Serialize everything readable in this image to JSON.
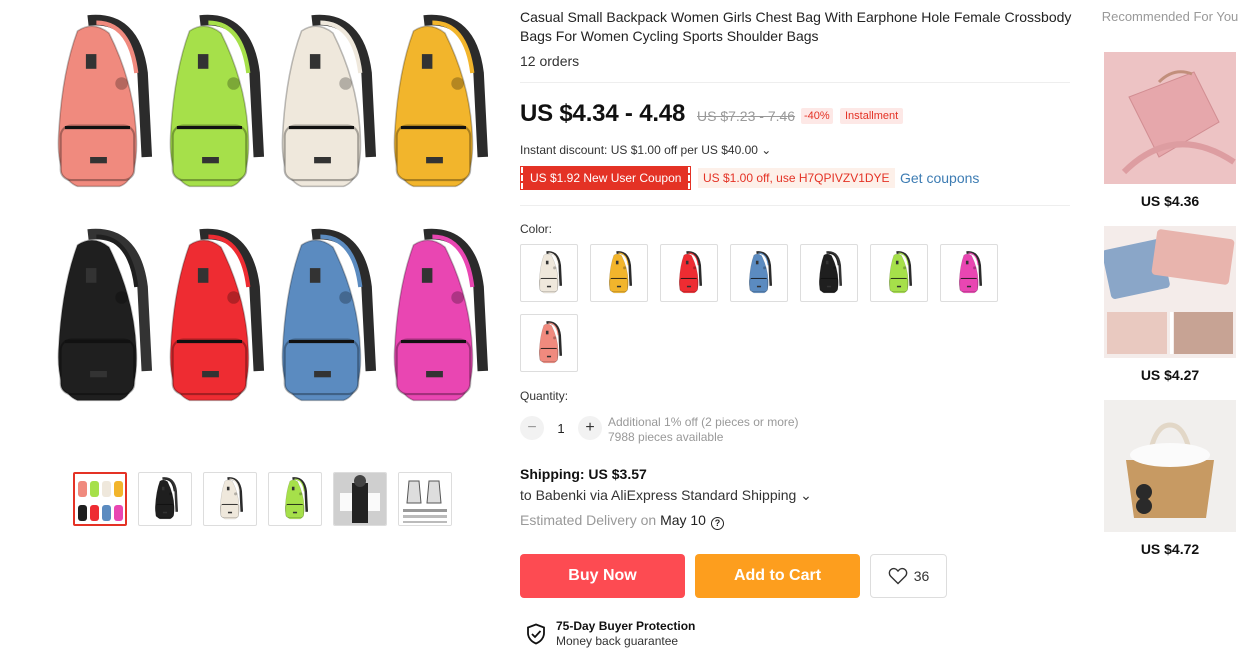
{
  "product": {
    "title": "Casual Small Backpack Women Girls Chest Bag With Earphone Hole Female Crossbody Bags For Women Cycling Sports Shoulder Bags",
    "orders": "12 orders",
    "price": "US $4.34 - 4.48",
    "original_price": "US $7.23 - 7.46",
    "discount": "-40%",
    "installment": "Installment",
    "instant_discount": "Instant discount: US $1.00 off per US $40.00 ⌄",
    "coupon_new_user": "US $1.92 New User Coupon",
    "coupon_code": "US $1.00 off, use H7QPIVZV1DYE",
    "get_coupons": "Get coupons"
  },
  "colors": {
    "accent": "#e43225",
    "buy": "#fd4b52",
    "cart": "#fd9e1e",
    "link": "#3d7cb3"
  },
  "gallery": {
    "main_bags": [
      "#f08a7e",
      "#a6e04a",
      "#efe8dc",
      "#f2b52c",
      "#1f1f1f",
      "#ee2c32",
      "#5b8bc0",
      "#e946b2"
    ],
    "thumbs": [
      "all-colors",
      "black",
      "cream",
      "green",
      "model-photo",
      "size-chart"
    ]
  },
  "color_label": "Color:",
  "swatches": [
    "#efe8dc",
    "#f2b52c",
    "#ee2c32",
    "#5b8bc0",
    "#1f1f1f",
    "#a6e04a",
    "#e946b2",
    "#f08a7e"
  ],
  "quantity": {
    "label": "Quantity:",
    "value": "1",
    "note1": "Additional 1% off (2 pieces or more)",
    "note2": "7988 pieces available"
  },
  "shipping": {
    "title": "Shipping: US $3.57",
    "to": "to Babenki via AliExpress Standard Shipping ⌄",
    "estimated_label": "Estimated Delivery on",
    "date": "May 10",
    "help": "?"
  },
  "actions": {
    "buy_now": "Buy Now",
    "add_to_cart": "Add to Cart",
    "wishlist_count": "36"
  },
  "protection": {
    "title": "75-Day Buyer Protection",
    "subtitle": "Money back guarantee"
  },
  "recommended": {
    "title": "Recommended For You",
    "items": [
      {
        "price": "US $4.36",
        "type": "pink-crossbody"
      },
      {
        "price": "US $4.27",
        "type": "wallets"
      },
      {
        "price": "US $4.72",
        "type": "straw-bag"
      }
    ]
  }
}
